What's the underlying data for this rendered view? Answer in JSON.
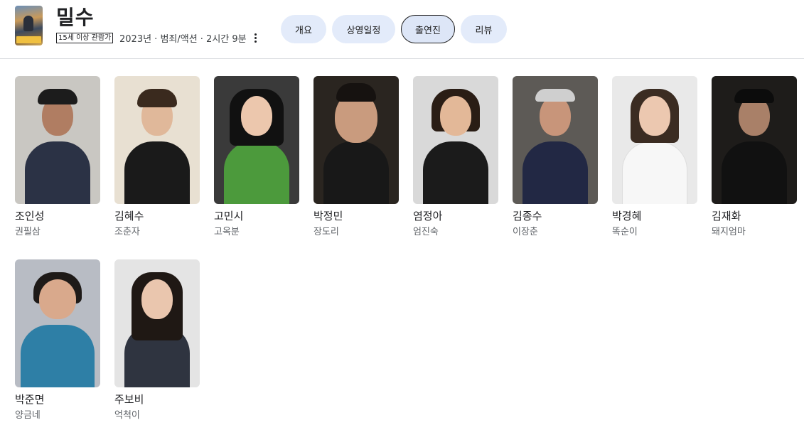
{
  "header": {
    "title": "밀수",
    "rating": "15세 이상 관람가",
    "meta": "2023년 · 범죄/액션 · 2시간 9분"
  },
  "tabs": [
    {
      "label": "개요"
    },
    {
      "label": "상영일정"
    },
    {
      "label": "출연진",
      "active": true
    },
    {
      "label": "리뷰"
    }
  ],
  "cast": [
    {
      "name": "조인성",
      "role": "권필삼"
    },
    {
      "name": "김혜수",
      "role": "조춘자"
    },
    {
      "name": "고민시",
      "role": "고옥분"
    },
    {
      "name": "박정민",
      "role": "장도리"
    },
    {
      "name": "염정아",
      "role": "엄진숙"
    },
    {
      "name": "김종수",
      "role": "이장춘"
    },
    {
      "name": "박경혜",
      "role": "똑순이"
    },
    {
      "name": "김재화",
      "role": "돼지엄마"
    },
    {
      "name": "박준면",
      "role": "양금네"
    },
    {
      "name": "주보비",
      "role": "억척이"
    }
  ]
}
